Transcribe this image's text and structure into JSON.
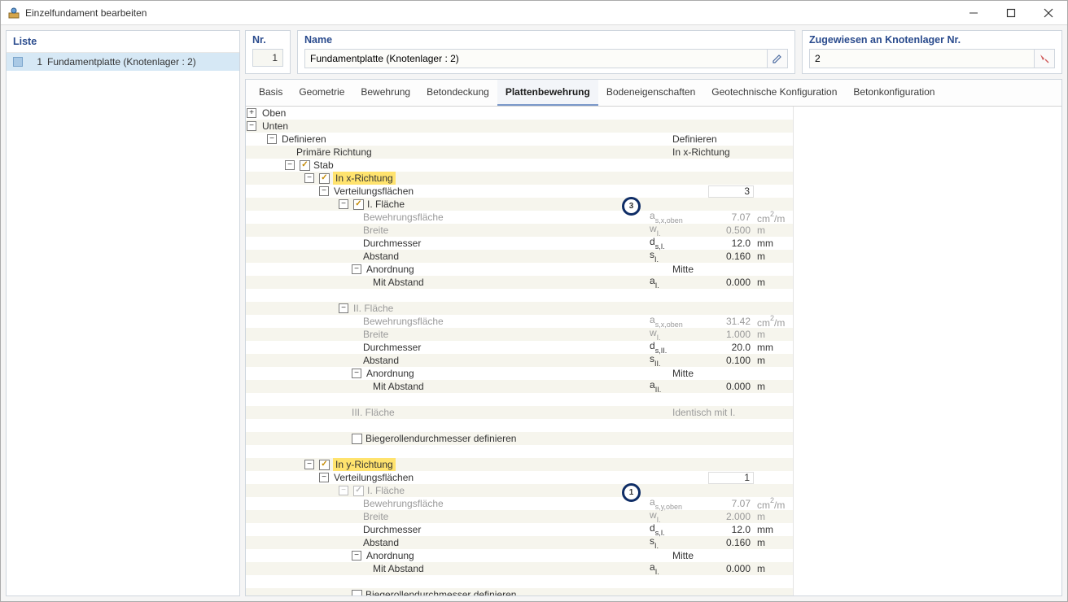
{
  "window": {
    "title": "Einzelfundament bearbeiten"
  },
  "leftPanel": {
    "header": "Liste",
    "item": {
      "num": "1",
      "text": "Fundamentplatte (Knotenlager : 2)"
    }
  },
  "top": {
    "nrLabel": "Nr.",
    "nrValue": "1",
    "nameLabel": "Name",
    "nameValue": "Fundamentplatte (Knotenlager : 2)",
    "assignLabel": "Zugewiesen an Knotenlager Nr.",
    "assignValue": "2"
  },
  "tabs": [
    "Basis",
    "Geometrie",
    "Bewehrung",
    "Betondeckung",
    "Plattenbewehrung",
    "Bodeneigenschaften",
    "Geotechnische Konfiguration",
    "Betonkonfiguration"
  ],
  "activeTab": 4,
  "tree": {
    "oben": "Oben",
    "unten": "Unten",
    "definieren": "Definieren",
    "definieren_val": "Definieren",
    "prim": "Primäre Richtung",
    "prim_val": "In x-Richtung",
    "stab": "Stab",
    "inx": "In x-Richtung",
    "verteil": "Verteilungsflächen",
    "verteil_n_x": "3",
    "iFlaeche": "I. Fläche",
    "bew": "Bewehrungsfläche",
    "breite": "Breite",
    "durch": "Durchmesser",
    "abstand": "Abstand",
    "anord": "Anordnung",
    "anord_val": "Mitte",
    "mitabst": "Mit Abstand",
    "iiFlaeche": "II. Fläche",
    "iiiFlaeche": "III. Fläche",
    "iii_val": "Identisch mit I.",
    "biege": "Biegerollendurchmesser definieren",
    "iny": "In y-Richtung",
    "verteil_n_y": "1",
    "sym": {
      "as_x_oben": "as,x,oben",
      "wi": "wI.",
      "ds1": "ds,I.",
      "s1": "sI.",
      "a1": "aI.",
      "ds2": "ds,II.",
      "s2": "sII.",
      "a2": "aII.",
      "as_y_oben": "as,y,oben"
    },
    "vals": {
      "bew_x1": "7.07",
      "breite_x1": "0.500",
      "d_x1": "12.0",
      "s_x1": "0.160",
      "a_x1": "0.000",
      "bew_x2": "31.42",
      "breite_x2": "1.000",
      "d_x2": "20.0",
      "s_x2": "0.100",
      "a_x2": "0.000",
      "bew_y1": "7.07",
      "breite_y1": "2.000",
      "d_y1": "12.0",
      "s_y1": "0.160",
      "a_y1": "0.000"
    },
    "units": {
      "cm2m": "cm²/m",
      "m": "m",
      "mm": "mm"
    }
  },
  "badges": {
    "b3": "3",
    "b1": "1"
  }
}
